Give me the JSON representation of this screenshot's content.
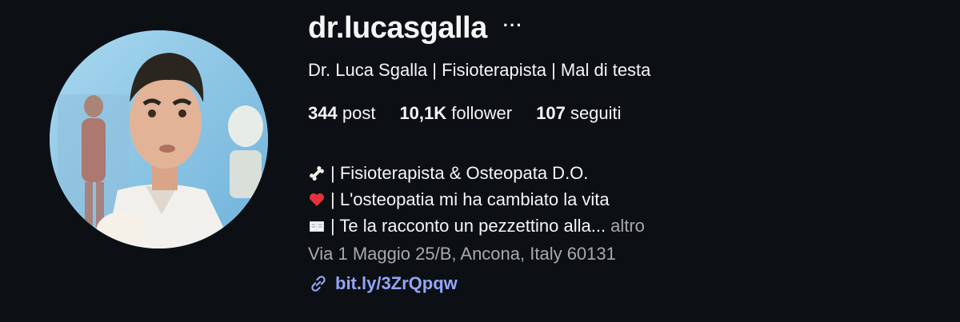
{
  "profile": {
    "username": "dr.lucasgalla",
    "more_label": "···",
    "full_name": "Dr. Luca Sgalla | Fisioterapista | Mal di testa",
    "stats": [
      {
        "count": "344",
        "label": "post"
      },
      {
        "count": "10,1K",
        "label": "follower"
      },
      {
        "count": "107",
        "label": "seguiti"
      }
    ],
    "bio": [
      {
        "icon": "bone-icon",
        "text": "| Fisioterapista & Osteopata D.O."
      },
      {
        "icon": "heart-icon",
        "text": "| L'osteopatia mi ha cambiato la vita"
      },
      {
        "icon": "book-icon",
        "text": "| Te la racconto un pezzettino alla..."
      }
    ],
    "more_text": "altro",
    "address": "Via 1 Maggio 25/B, Ancona, Italy 60131",
    "link": "bit.ly/3ZrQpqw"
  },
  "colors": {
    "background": "#0c1014",
    "text": "#f5f5f5",
    "secondary": "#a8a8a8",
    "link": "#93a5f7"
  }
}
